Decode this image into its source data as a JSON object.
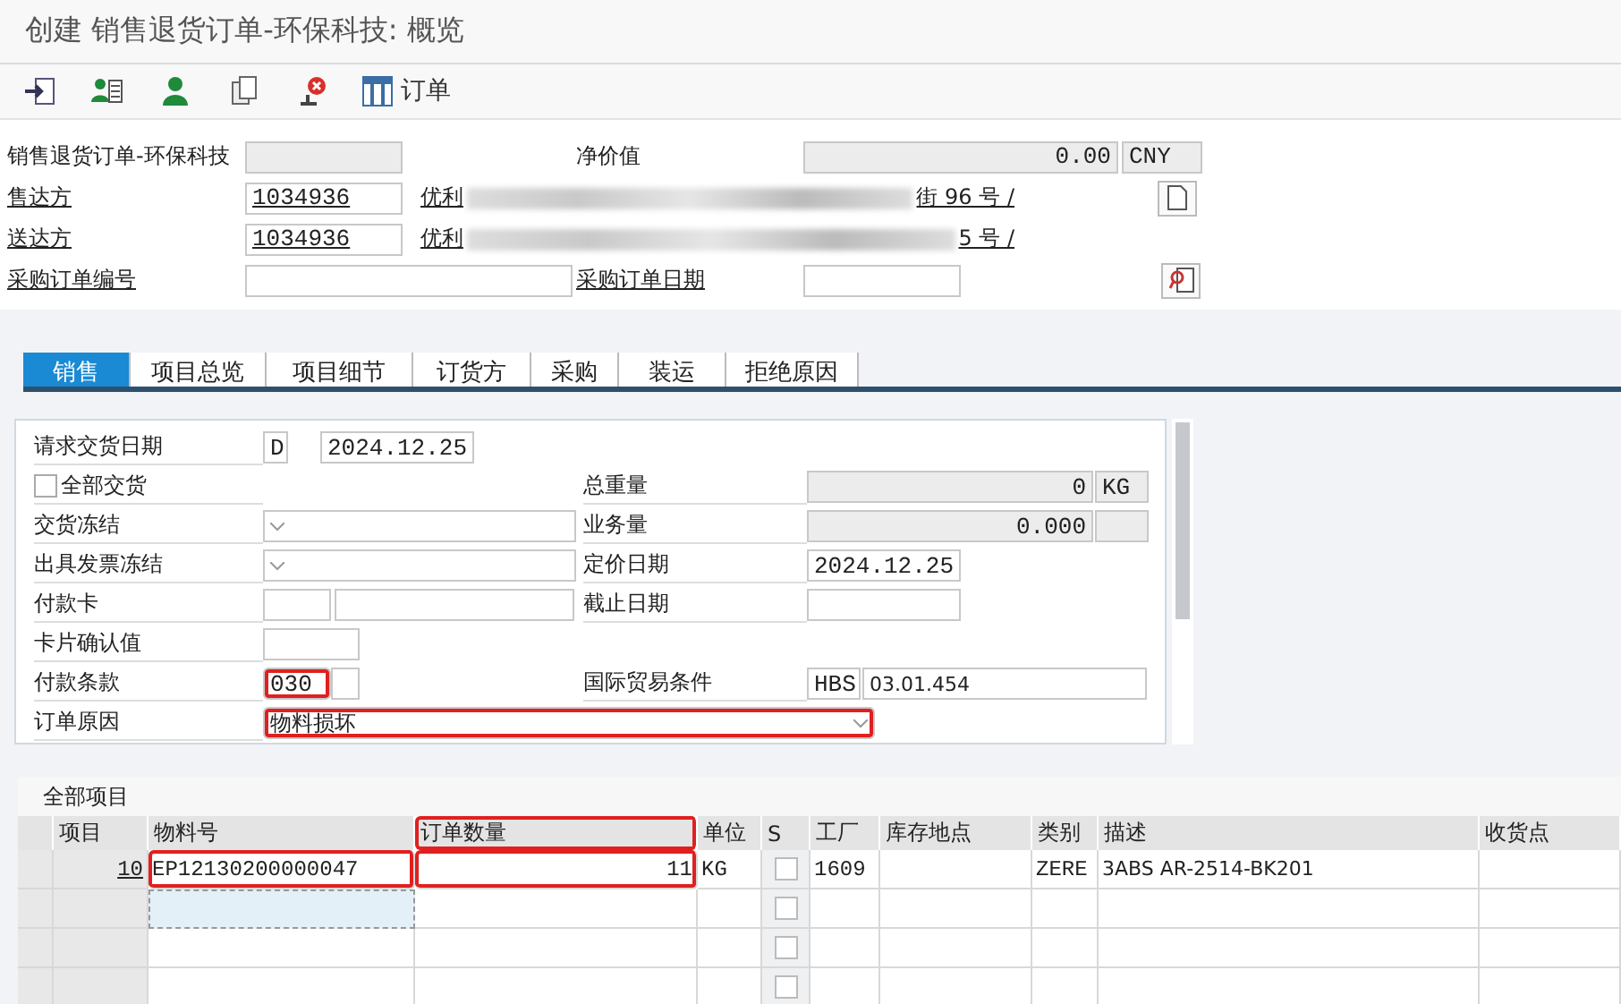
{
  "window": {
    "title": "创建 销售退货订单-环保科技: 概览"
  },
  "toolbar": {
    "order_button": "订单"
  },
  "header": {
    "order_type_label": "销售退货订单-环保科技",
    "net_value_label": "净价值",
    "net_value": "0.00",
    "currency": "CNY",
    "sold_to": {
      "label": "售达方",
      "number": "1034936",
      "address_start": "优利",
      "address_end": "街 96 号 /"
    },
    "ship_to": {
      "label": "送达方",
      "number": "1034936",
      "address_start": "优利",
      "address_end": "5 号 /"
    },
    "po_number_label": "采购订单编号",
    "po_date_label": "采购订单日期"
  },
  "tabs": [
    {
      "label": "销售",
      "selected": true
    },
    {
      "label": "项目总览",
      "selected": false
    },
    {
      "label": "项目细节",
      "selected": false
    },
    {
      "label": "订货方",
      "selected": false
    },
    {
      "label": "采购",
      "selected": false
    },
    {
      "label": "装运",
      "selected": false
    },
    {
      "label": "拒绝原因",
      "selected": false
    }
  ],
  "sales_rows": [
    {
      "left": {
        "kind": "date",
        "label": "请求交货日期",
        "code": "D",
        "value": "2024.12.25"
      }
    },
    {
      "left": {
        "kind": "checkbox",
        "label": "全部交货",
        "checked": false
      },
      "right": {
        "kind": "amount",
        "label": "总重量",
        "value": "0",
        "unit": "KG"
      }
    },
    {
      "left": {
        "kind": "dropdown",
        "label": "交货冻结"
      },
      "right": {
        "kind": "amount",
        "label": "业务量",
        "value": "0.000"
      }
    },
    {
      "left": {
        "kind": "dropdown",
        "label": "出具发票冻结"
      },
      "right": {
        "kind": "field",
        "label": "定价日期",
        "value": "2024.12.25"
      }
    },
    {
      "left": {
        "kind": "split",
        "label": "付款卡"
      },
      "right": {
        "kind": "field",
        "label": "截止日期"
      }
    },
    {
      "left": {
        "kind": "short",
        "label": "卡片确认值"
      }
    },
    {
      "left": {
        "kind": "terms",
        "label": "付款条款",
        "value": "030",
        "highlighted": true
      },
      "right": {
        "kind": "incoterms",
        "label": "国际贸易条件",
        "code": "HBS",
        "value": "03.01.454"
      }
    },
    {
      "left": {
        "kind": "wide_dropdown",
        "label": "订单原因",
        "value": "物料损坏",
        "highlighted": true
      }
    }
  ],
  "items": {
    "title": "全部项目",
    "columns": [
      {
        "label": "项目",
        "highlighted": false
      },
      {
        "label": "物料号",
        "highlighted": false
      },
      {
        "label": "订单数量",
        "highlighted": true
      },
      {
        "label": "单位",
        "highlighted": false
      },
      {
        "label": "S",
        "highlighted": false
      },
      {
        "label": "工厂",
        "highlighted": false
      },
      {
        "label": "库存地点",
        "highlighted": false
      },
      {
        "label": "类别",
        "highlighted": false
      },
      {
        "label": "描述",
        "highlighted": false
      },
      {
        "label": "收货点",
        "highlighted": false
      }
    ],
    "rows": [
      {
        "item": "10",
        "material": "EP12130200000047",
        "material_highlighted": true,
        "material_focused": false,
        "quantity": "11",
        "unit": "KG",
        "s_checked": false,
        "plant": "1609",
        "category": "ZERE",
        "description": "3ABS AR-2514-BK201"
      },
      {
        "material_highlighted": false,
        "material_focused": true,
        "s_checked": false
      },
      {
        "material_highlighted": false,
        "material_focused": false,
        "s_checked": false
      },
      {
        "material_highlighted": false,
        "material_focused": false,
        "s_checked": false
      }
    ]
  }
}
